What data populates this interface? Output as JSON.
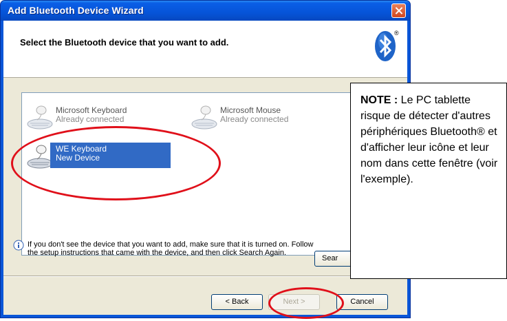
{
  "window": {
    "title": "Add Bluetooth Device Wizard"
  },
  "header": {
    "title": "Select the Bluetooth device that you want to add."
  },
  "devices": [
    {
      "name": "Microsoft Keyboard",
      "status": "Already connected",
      "selected": false
    },
    {
      "name": "Microsoft Mouse",
      "status": "Already connected",
      "selected": false
    },
    {
      "name": "WE Keyboard",
      "status": "New Device",
      "selected": true
    }
  ],
  "info": {
    "text": "If you don't see the device that you want to add, make sure that it is turned on. Follow the setup instructions that came with the device, and then click Search Again.",
    "search_button_label": "Sear"
  },
  "buttons": {
    "back": "< Back",
    "next": "Next >",
    "cancel": "Cancel"
  },
  "note": {
    "label": "NOTE :",
    "text": "Le PC tablette risque de détecter d'autres périphériques Bluetooth® et d'afficher leur icône et leur nom dans cette fenêtre (voir l'exemple)."
  },
  "colors": {
    "titlebar": "#0654d8",
    "selection": "#316ac5",
    "annotation": "#e0101a"
  }
}
